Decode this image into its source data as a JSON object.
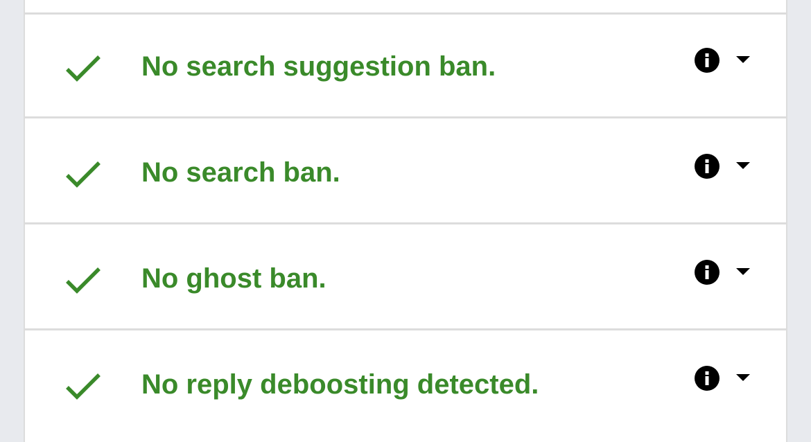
{
  "checks": [
    {
      "label": "No search suggestion ban.",
      "status_icon": "checkmark-icon",
      "info_icon": "info-icon",
      "toggle_icon": "caret-down-icon"
    },
    {
      "label": "No search ban.",
      "status_icon": "checkmark-icon",
      "info_icon": "info-icon",
      "toggle_icon": "caret-down-icon"
    },
    {
      "label": "No ghost ban.",
      "status_icon": "checkmark-icon",
      "info_icon": "info-icon",
      "toggle_icon": "caret-down-icon"
    },
    {
      "label": "No reply deboosting detected.",
      "status_icon": "checkmark-icon",
      "info_icon": "info-icon",
      "toggle_icon": "caret-down-icon"
    }
  ],
  "colors": {
    "success_green": "#3a8a2a",
    "divider": "#dcdcdc",
    "page_background": "#e8eaee",
    "card_background": "#ffffff"
  }
}
